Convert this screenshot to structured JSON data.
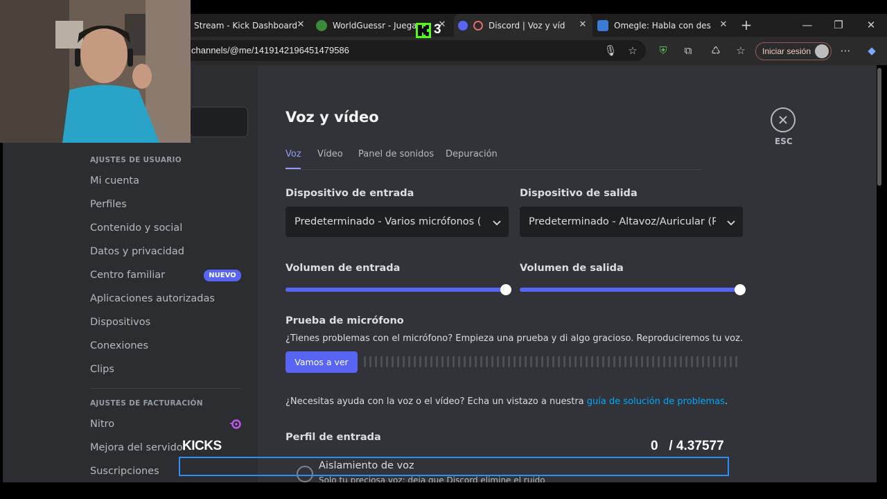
{
  "browser": {
    "tabs": [
      {
        "title": "Stream - Kick Dashboard"
      },
      {
        "title": "WorldGuessr - Juega G"
      },
      {
        "title": "Discord | Voz y vídeo"
      },
      {
        "title": "Omegle: Habla con descon"
      }
    ],
    "url": "channels/@me/1419142196451479586",
    "signin_label": "Iniciar sesión"
  },
  "sidebar": {
    "user_section": "AJUSTES DE USUARIO",
    "user_items": [
      {
        "label": "Mi cuenta"
      },
      {
        "label": "Perfiles"
      },
      {
        "label": "Contenido y social"
      },
      {
        "label": "Datos y privacidad"
      },
      {
        "label": "Centro familiar"
      },
      {
        "label": "Aplicaciones autorizadas"
      },
      {
        "label": "Dispositivos"
      },
      {
        "label": "Conexiones"
      },
      {
        "label": "Clips"
      }
    ],
    "new_badge": "NUEVO",
    "billing_section": "AJUSTES DE FACTURACIÓN",
    "billing_items": [
      {
        "label": "Nitro"
      },
      {
        "label": "Mejora del servidor"
      },
      {
        "label": "Suscripciones"
      }
    ]
  },
  "main": {
    "title": "Voz y vídeo",
    "tabs": [
      {
        "label": "Voz"
      },
      {
        "label": "Vídeo"
      },
      {
        "label": "Panel de sonidos"
      },
      {
        "label": "Depuración"
      }
    ],
    "input_device_label": "Dispositivo de entrada",
    "input_device_value": "Predeterminado - Varios micrófonos (R",
    "output_device_label": "Dispositivo de salida",
    "output_device_value": "Predeterminado - Altavoz/Auricular (R",
    "input_volume_label": "Volumen de entrada",
    "input_volume_fraction": 1.0,
    "output_volume_label": "Volumen de salida",
    "output_volume_fraction": 1.0,
    "mic_test_title": "Prueba de micrófono",
    "mic_test_desc": "¿Tienes problemas con el micrófono? Empieza una prueba y di algo gracioso. Reproduciremos tu voz.",
    "mic_test_button": "Vamos a ver",
    "help_text": "¿Necesitas ayuda con la voz o el vídeo? Echa un vistazo a nuestra ",
    "help_link": "guía de solución de problemas",
    "help_end": ".",
    "input_profile_label": "Perfil de entrada",
    "voice_isolation_title": "Aislamiento de voz",
    "voice_isolation_desc": "Solo tu preciosa voz: deja que Discord elimine el ruido",
    "esc_label": "ESC"
  },
  "overlay": {
    "kick_count": "3",
    "kicks_label": "KICKS",
    "kicks_ratio": "0   / 4.37577"
  },
  "colors": {
    "accent": "#5865f2",
    "link": "#00a8fc",
    "sidebar_bg": "#2b2d31",
    "content_bg": "#313338",
    "kick_green": "#53fc18"
  }
}
